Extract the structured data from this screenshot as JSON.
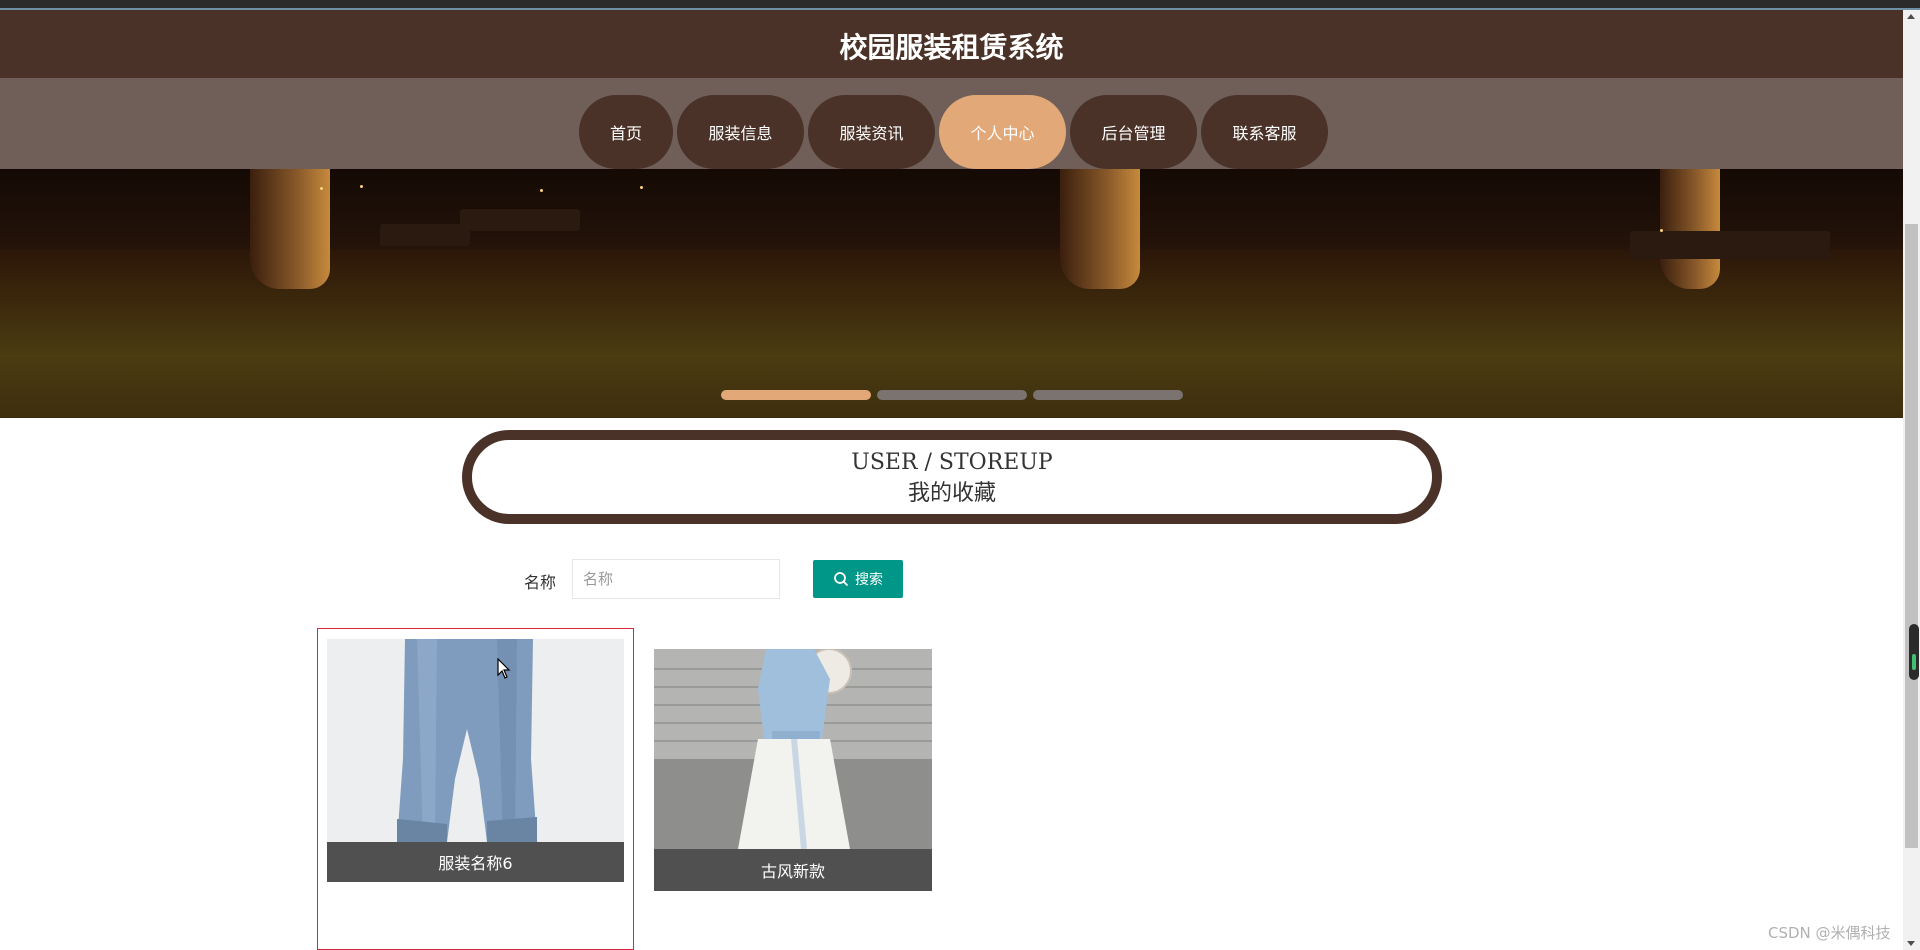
{
  "site_title": "校园服装租赁系统",
  "nav": {
    "items": [
      {
        "label": "首页",
        "active": false
      },
      {
        "label": "服装信息",
        "active": false
      },
      {
        "label": "服装资讯",
        "active": false
      },
      {
        "label": "个人中心",
        "active": true
      },
      {
        "label": "后台管理",
        "active": false
      },
      {
        "label": "联系客服",
        "active": false
      }
    ]
  },
  "carousel": {
    "slide_count": 3,
    "active_index": 0
  },
  "section": {
    "title_en": "USER / STOREUP",
    "title_cn": "我的收藏"
  },
  "search": {
    "label": "名称",
    "placeholder": "名称",
    "value": "",
    "button_label": "搜索"
  },
  "favorites": [
    {
      "name": "服装名称6",
      "image": "denim-jeans-photo"
    },
    {
      "name": "古风新款",
      "image": "hanfu-outfit-photo"
    }
  ],
  "watermark": "CSDN @米偶科技",
  "colors": {
    "header": "#4a3228",
    "nav_bar": "#6f5f58",
    "nav_active": "#e2a878",
    "search_button": "#009688",
    "caption_bg": "#505050",
    "card_selected_border": "#d9263a"
  }
}
